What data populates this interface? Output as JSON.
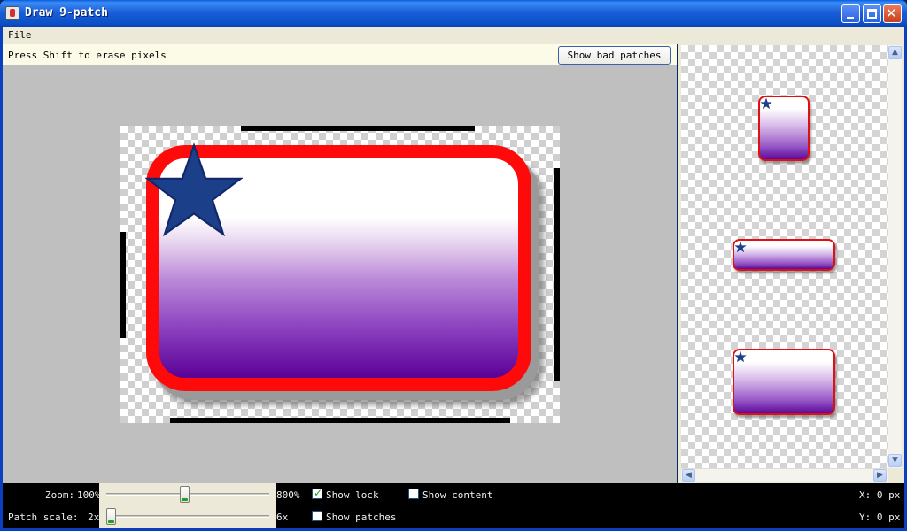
{
  "window": {
    "title": "Draw 9-patch",
    "icon": "java-app-icon",
    "controls": [
      "minimize-icon",
      "maximize-icon",
      "close-icon"
    ]
  },
  "menu": {
    "items": [
      {
        "label": "File"
      }
    ]
  },
  "editor": {
    "hint": "Press Shift to erase pixels",
    "bad_patches_button": "Show bad patches"
  },
  "preview": {
    "items": [
      "vertical-stretch",
      "horizontal-stretch",
      "both-stretch"
    ],
    "scroll_up": "▲",
    "scroll_down": "▼",
    "scroll_left": "◀",
    "scroll_right": "▶"
  },
  "controls": {
    "zoom": {
      "label": "Zoom:",
      "min": "100%",
      "max": "800%",
      "position": 0.48
    },
    "patch_scale": {
      "label": "Patch scale:",
      "min": "2x",
      "max": "6x",
      "position": 0.0
    },
    "show_lock": {
      "label": "Show lock",
      "checked": true,
      "mark": "✓"
    },
    "show_content": {
      "label": "Show content",
      "checked": false
    },
    "show_patches": {
      "label": "Show patches",
      "checked": false
    },
    "x_readout": "X: 0 px",
    "y_readout": "Y: 0 px"
  },
  "colors": {
    "border": "#ff0a0a",
    "gradient_top": "#ffffff",
    "gradient_bottom": "#5a0096",
    "star": "#1c3f8a"
  }
}
